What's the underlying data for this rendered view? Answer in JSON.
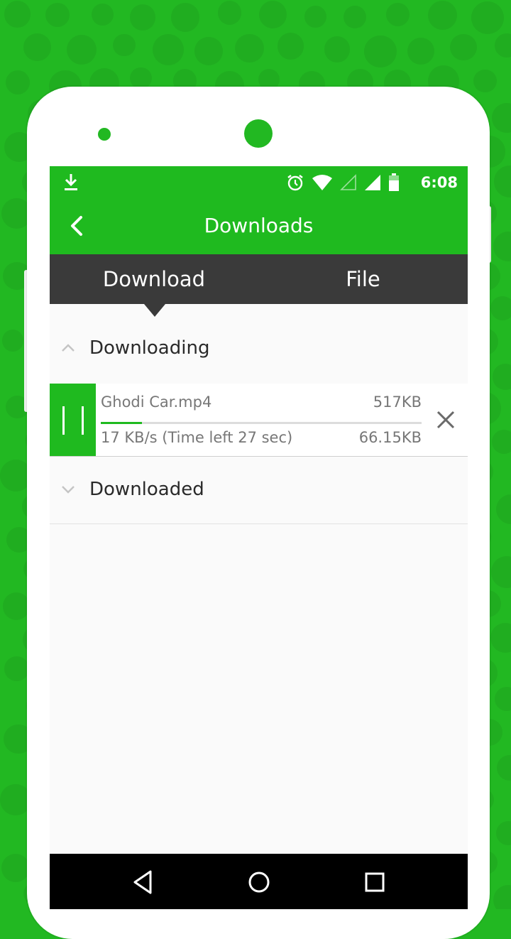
{
  "status_bar": {
    "time": "6:08",
    "icons": [
      "download-icon",
      "alarm-icon",
      "wifi-icon",
      "signal-empty-icon",
      "signal-full-icon",
      "battery-icon"
    ]
  },
  "app_bar": {
    "title": "Downloads",
    "back_icon": "chevron-left-icon"
  },
  "tabs": [
    {
      "label": "Download",
      "active": true
    },
    {
      "label": "File",
      "active": false
    }
  ],
  "sections": {
    "downloading": {
      "label": "Downloading",
      "expanded": true
    },
    "downloaded": {
      "label": "Downloaded",
      "expanded": false
    }
  },
  "download_item": {
    "name": "Ghodi Car.mp4",
    "total_size": "517KB",
    "speed": "17 KB/s  (Time left 27 sec)",
    "downloaded": "66.15KB",
    "progress": 0.128
  },
  "colors": {
    "accent": "#1fba1f",
    "tab_bar": "#3a3a3a",
    "background": "#22b822"
  }
}
